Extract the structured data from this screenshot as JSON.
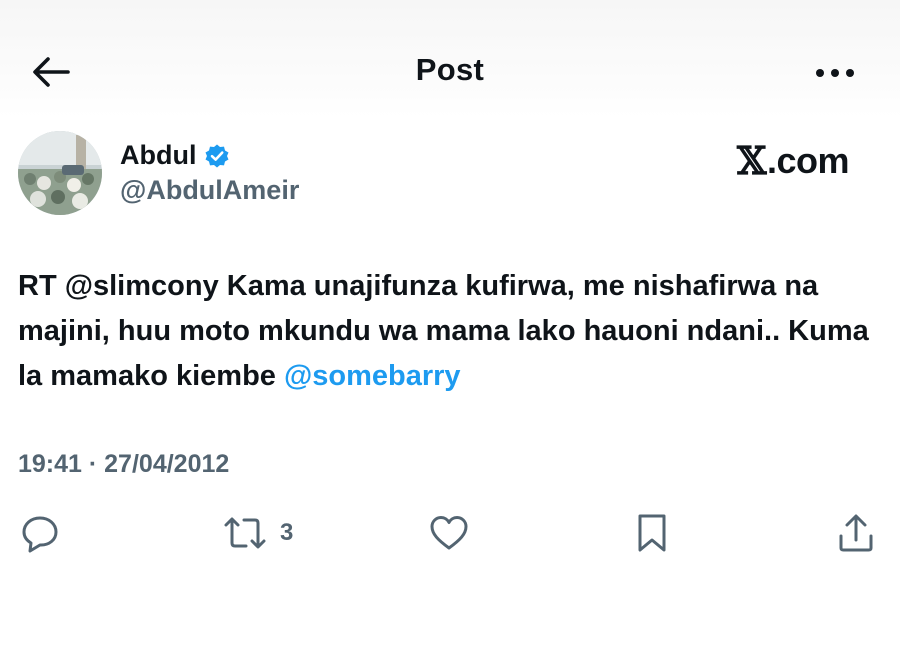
{
  "header": {
    "title": "Post",
    "back_icon": "arrow-left-icon",
    "more_icon": "more-horizontal-icon"
  },
  "author": {
    "name": "Abdul",
    "handle": "@AbdulAmeir",
    "verified": true,
    "verified_badge_color": "#1d9bf0"
  },
  "watermark": {
    "brand_glyph": "𝕏",
    "brand_text": ".com"
  },
  "post": {
    "text_prefix": "RT @slimcony Kama unajifunza kufirwa, me nishafirwa na majini, huu moto mkundu wa mama lako hauoni ndani.. Kuma la mamako kiembe ",
    "mention": "@somebarry",
    "timestamp": "19:41 · 27/04/2012"
  },
  "actions": {
    "reply_icon": "reply-icon",
    "repost_icon": "repost-icon",
    "repost_count": "3",
    "like_icon": "heart-icon",
    "bookmark_icon": "bookmark-icon",
    "share_icon": "share-icon"
  },
  "colors": {
    "text": "#0f1419",
    "secondary": "#536471",
    "link": "#1d9bf0"
  }
}
